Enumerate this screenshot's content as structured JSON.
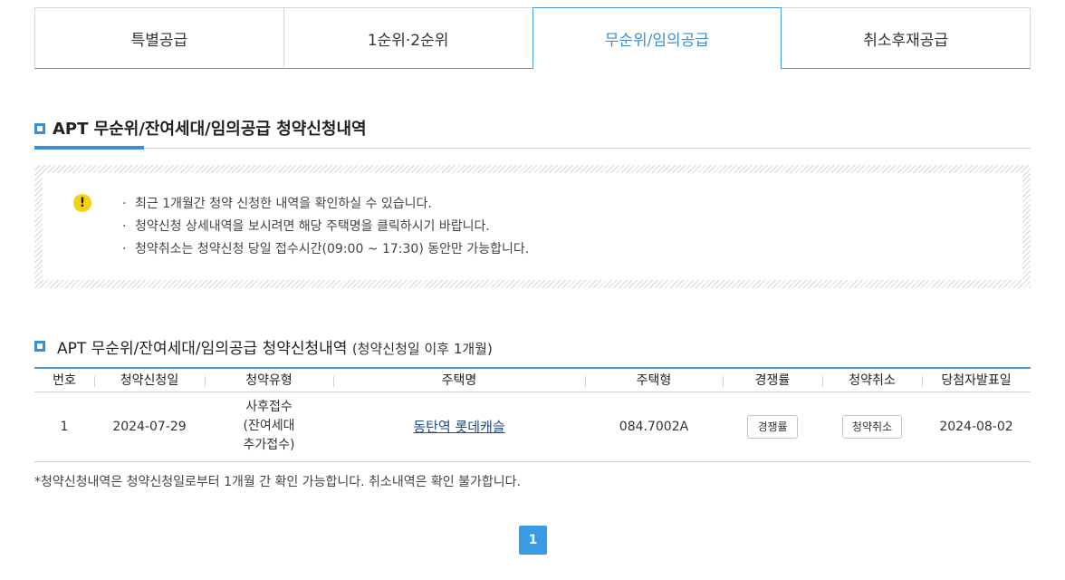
{
  "tabs": [
    {
      "label": "특별공급"
    },
    {
      "label": "1순위·2순위"
    },
    {
      "label": "무순위/임의공급"
    },
    {
      "label": "취소후재공급"
    }
  ],
  "section1": {
    "title": "APT 무순위/잔여세대/임의공급 청약신청내역"
  },
  "notice": {
    "icon": "warning-icon",
    "lines": [
      "최근 1개월간 청약 신청한 내역을 확인하실 수 있습니다.",
      "청약신청 상세내역을 보시려면 해당 주택명을 클릭하시기 바랍니다.",
      "청약취소는 청약신청 당일 접수시간(09:00 ~ 17:30) 동안만 가능합니다."
    ]
  },
  "section2": {
    "title": "APT 무순위/잔여세대/임의공급 청약신청내역",
    "subtitle": "(청약신청일 이후 1개월)"
  },
  "table": {
    "headers": [
      "번호",
      "청약신청일",
      "청약유형",
      "주택명",
      "주택형",
      "경쟁률",
      "청약취소",
      "당첨자발표일"
    ],
    "rows": [
      {
        "no": "1",
        "date": "2024-07-29",
        "type_lines": [
          "사후접수",
          "(잔여세대",
          "추가접수)"
        ],
        "house": "동탄역 롯데캐슬",
        "housing_type": "084.7002A",
        "competition_btn": "경쟁률",
        "cancel_btn": "청약취소",
        "announce": "2024-08-02"
      }
    ]
  },
  "footnote": "*청약신청내역은 청약신청일로부터 1개월 간 확인 가능합니다. 취소내역은 확인 불가합니다.",
  "pagination": {
    "current": "1"
  }
}
